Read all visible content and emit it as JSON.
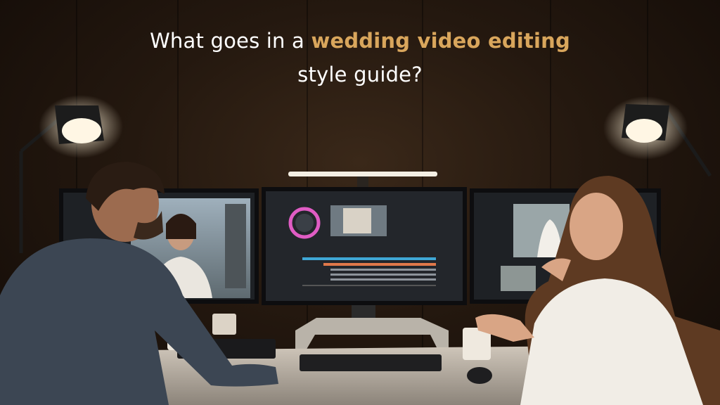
{
  "headline": {
    "line1_prefix": "What goes in a ",
    "line1_highlight": "wedding video editing",
    "line2": "style guide?"
  },
  "colors": {
    "highlight": "#d9a65c",
    "text": "#ffffff",
    "background": "#24180f"
  }
}
